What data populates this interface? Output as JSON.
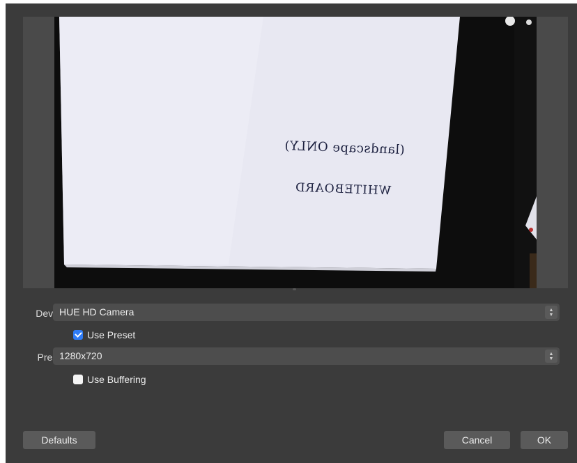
{
  "preview": {
    "handwriting_line1": "(landscape ONLY)",
    "handwriting_line2": "WHITEBOARD"
  },
  "form": {
    "device_label": "Device",
    "device_value": "HUE HD Camera",
    "use_preset_label": "Use Preset",
    "use_preset_checked": true,
    "preset_label": "Preset",
    "preset_value": "1280x720",
    "use_buffering_label": "Use Buffering",
    "use_buffering_checked": false
  },
  "buttons": {
    "defaults": "Defaults",
    "cancel": "Cancel",
    "ok": "OK"
  },
  "icons": {
    "select_arrows": "updown-chevron-icon",
    "checkbox_check": "checkmark-icon"
  },
  "colors": {
    "accent": "#2f7cf6",
    "dialog_bg": "#3b3b3b",
    "control_bg": "#4d4d4d"
  }
}
